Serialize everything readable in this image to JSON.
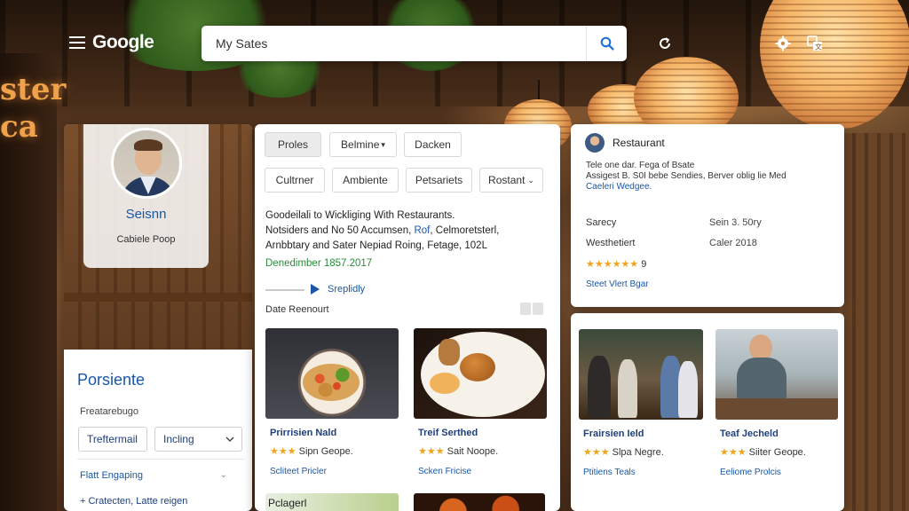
{
  "topbar": {
    "logo": "Google",
    "search_value": "My Sates"
  },
  "left": {
    "profile_name": "Seisnn",
    "profile_sub": "Cabiele Poop",
    "heading": "Porsiente",
    "label": "Freatarebugo",
    "field1": "Treftermail",
    "field2": "Incling",
    "link1": "Flatt Engaping",
    "link2": "+ Cratecten, Latte reigen"
  },
  "middle": {
    "chips_row1": [
      "Proles",
      "Belmine",
      "Dacken"
    ],
    "chips_row2": [
      "Cultrner",
      "Ambiente",
      "Petsariets",
      "Rostant"
    ],
    "desc_line1": "Goodeilali to Wickliging With Restaurants.",
    "desc_line2_a": "Notsiders and No 50 Accumsen, ",
    "desc_line2_link": "Rof",
    "desc_line2_b": ", Celmoretsterl,",
    "desc_line3": "Arnbbtary and Sater Nepiad Roing, Fetage, 102L",
    "date_green": "Denedimber 1857.2017",
    "play_label": "Sreplidly",
    "date_label": "Date Reenourt",
    "cards": [
      {
        "title": "Prirrisien Nald",
        "rating": "Sipn Geope.",
        "link": "Scliteet Pricler"
      },
      {
        "title": "Treif Serthed",
        "rating": "Sait Noope.",
        "link": "Scken Fricise"
      }
    ],
    "peek_label": "Pclagerl"
  },
  "right": {
    "title": "Restaurant",
    "desc_line1": "Tele one dar. Fega of Bsate",
    "desc_line2": "Assigest B. S0I bebe Sendies, Berver oblig lie Med",
    "desc_line3": "Caeleri Wedgee.",
    "row1_label": "Sarecy",
    "row1_value": "Sein 3. 50ry",
    "row2_label": "Westhetiert",
    "row2_value": "Caler 2018",
    "rating_count": "9",
    "link": "Steet Vlert Bgar",
    "cards": [
      {
        "title": "Frairsien Ield",
        "rating": "Slpa Negre.",
        "link": "Ptitiens Teals"
      },
      {
        "title": "Teaf Jecheld",
        "rating": "Siiter Geope.",
        "link": "Eeliome Prolcis"
      }
    ]
  },
  "ratings": {
    "stars_small": "★★★",
    "stars_five": "★★★★★★"
  },
  "colors": {
    "accent_blue": "#1a57a8",
    "star_orange": "#f2a41c",
    "date_green": "#2a8a3a"
  },
  "icons": [
    "menu-icon",
    "search-icon",
    "refresh-icon",
    "settings-icon",
    "translate-icon",
    "play-icon",
    "chevron-down-icon"
  ]
}
